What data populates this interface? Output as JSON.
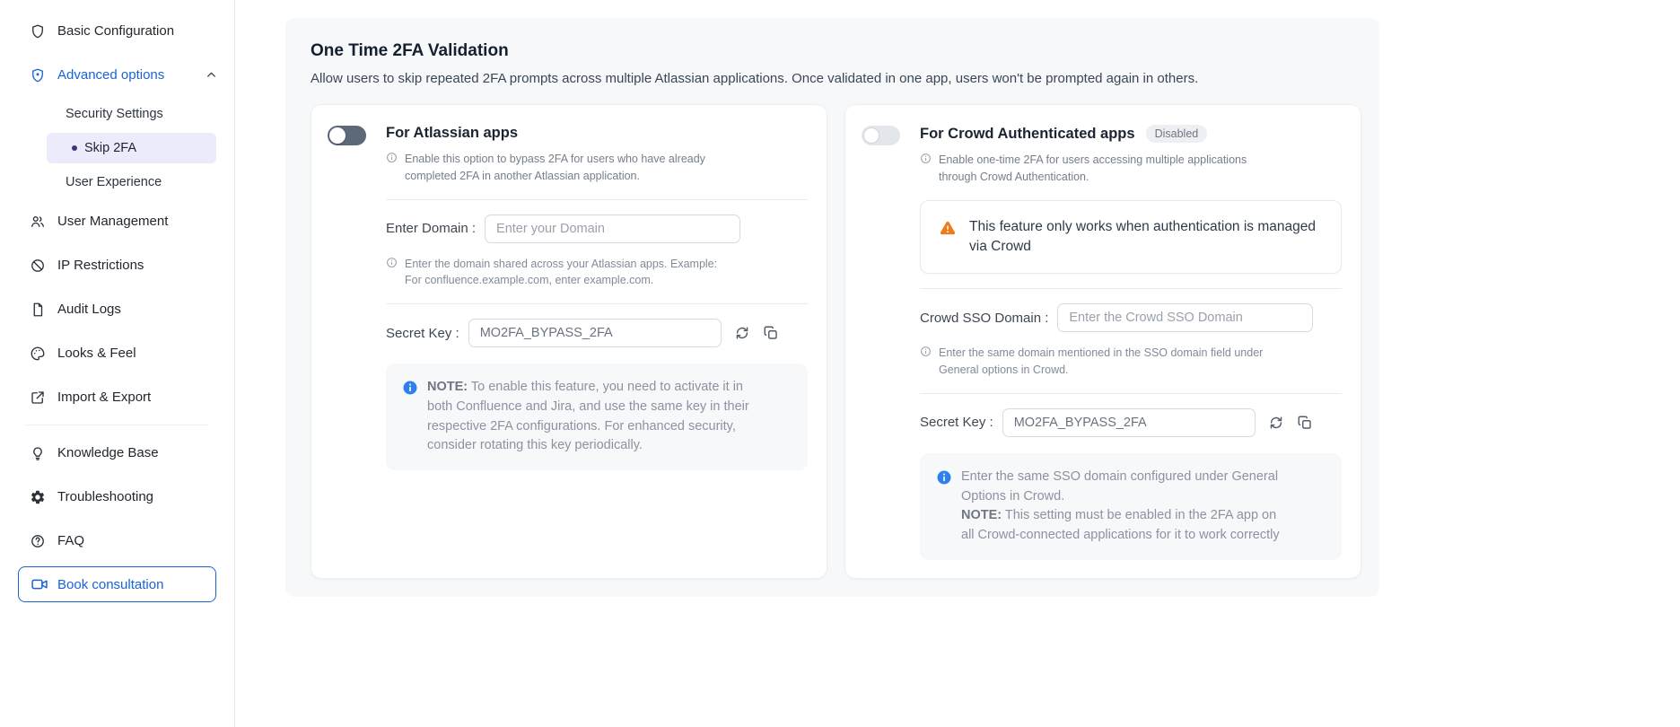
{
  "colors": {
    "accent": "#1a63d6",
    "warning": "#ee7c1b",
    "info": "#2f80ed"
  },
  "sidebar": {
    "items": [
      {
        "label": "Basic Configuration"
      },
      {
        "label": "Advanced options"
      },
      {
        "label": "User Management"
      },
      {
        "label": "IP Restrictions"
      },
      {
        "label": "Audit Logs"
      },
      {
        "label": "Looks & Feel"
      },
      {
        "label": "Import & Export"
      },
      {
        "label": "Knowledge Base"
      },
      {
        "label": "Troubleshooting"
      },
      {
        "label": "FAQ"
      }
    ],
    "advanced_children": {
      "security": "Security Settings",
      "skip2fa": "Skip 2FA",
      "user_experience": "User Experience"
    },
    "book_consultation": "Book consultation"
  },
  "main": {
    "title": "One Time 2FA Validation",
    "subtitle": "Allow users to skip repeated 2FA prompts across multiple Atlassian applications. Once validated in one app, users won't be prompted again in others.",
    "atlassian": {
      "title": "For Atlassian apps",
      "description": "Enable this option to bypass 2FA for users who have already completed 2FA in another Atlassian application.",
      "domain_label": "Enter Domain :",
      "domain_placeholder": "Enter your Domain",
      "domain_help": "Enter the domain shared across your Atlassian apps. Example: For confluence.example.com, enter example.com.",
      "secret_label": "Secret Key :",
      "secret_value": "MO2FA_BYPASS_2FA",
      "note_label": "NOTE:",
      "note_text": "To enable this feature, you need to activate it in both Confluence and Jira, and use the same key in their respective 2FA configurations. For enhanced security, consider rotating this key periodically."
    },
    "crowd": {
      "title": "For Crowd Authenticated apps",
      "badge": "Disabled",
      "description": "Enable one-time 2FA for users accessing multiple applications through Crowd Authentication.",
      "warning": "This feature only works when authentication is managed via Crowd",
      "domain_label": "Crowd SSO Domain :",
      "domain_placeholder": "Enter the Crowd SSO Domain",
      "domain_help": "Enter the same domain mentioned in the SSO domain field under General options in Crowd.",
      "secret_label": "Secret Key :",
      "secret_value": "MO2FA_BYPASS_2FA",
      "note_line1": "Enter the same SSO domain configured under General Options in Crowd.",
      "note_label": "NOTE:",
      "note_text": "This setting must be enabled in the 2FA app on all Crowd-connected applications for it to work correctly"
    }
  }
}
